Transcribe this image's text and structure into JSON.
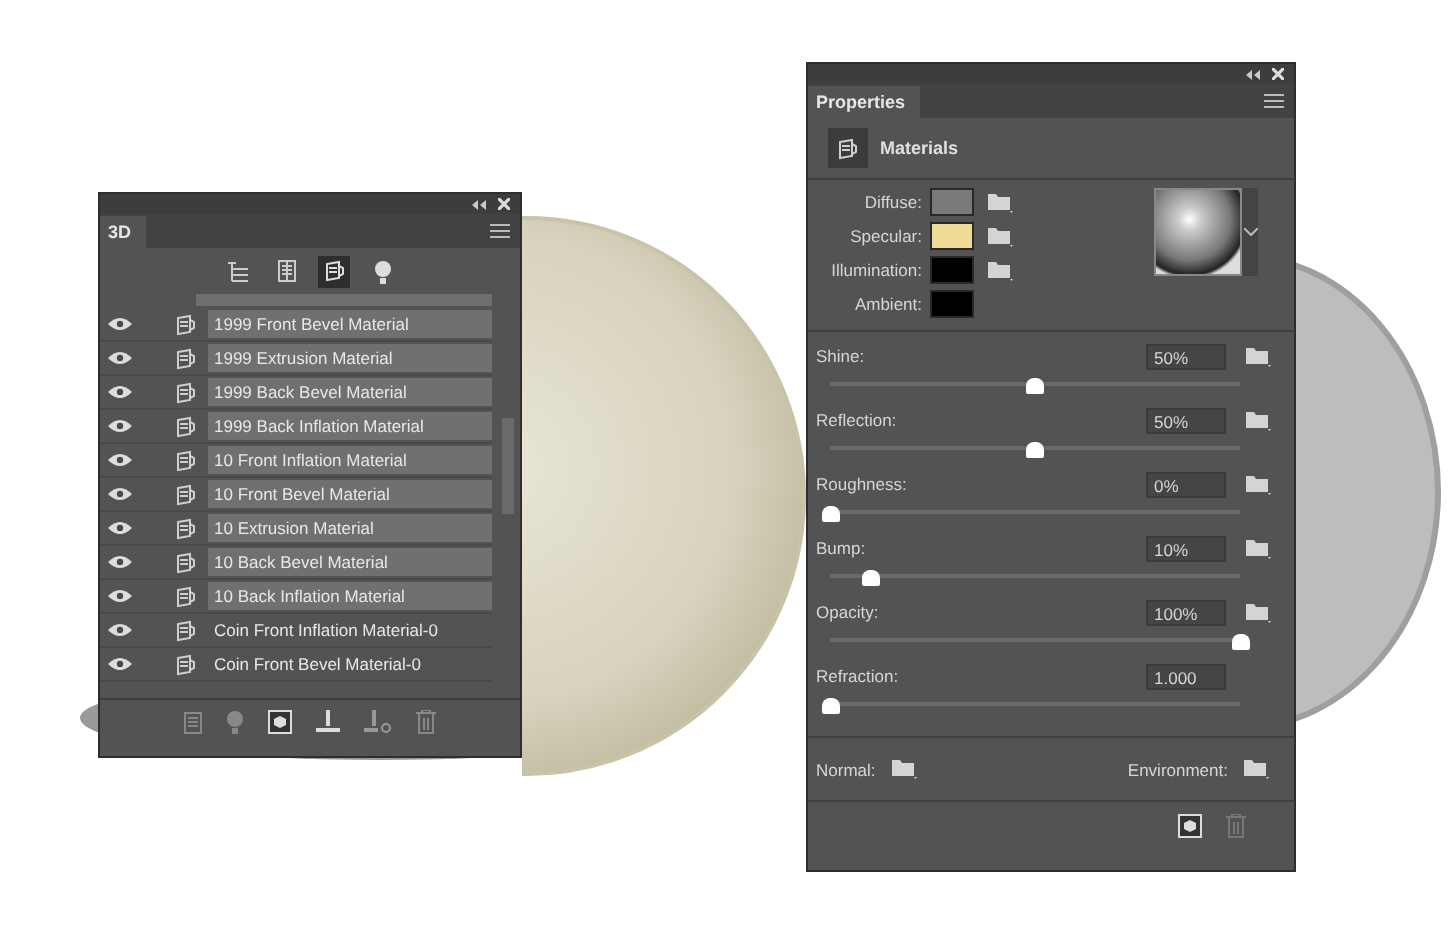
{
  "panel_3d": {
    "tab": "3D",
    "toolbar": [
      {
        "kind": "scene",
        "selected": false
      },
      {
        "kind": "mesh",
        "selected": false
      },
      {
        "kind": "material",
        "selected": true
      },
      {
        "kind": "light",
        "selected": false
      }
    ],
    "items": [
      {
        "label": "1999 Front Bevel Material",
        "visible": true,
        "selected": true
      },
      {
        "label": "1999 Extrusion Material",
        "visible": true,
        "selected": true
      },
      {
        "label": "1999 Back Bevel Material",
        "visible": true,
        "selected": true
      },
      {
        "label": "1999 Back Inflation Material",
        "visible": true,
        "selected": true
      },
      {
        "label": "10 Front Inflation Material",
        "visible": true,
        "selected": true
      },
      {
        "label": "10 Front Bevel Material",
        "visible": true,
        "selected": true
      },
      {
        "label": "10 Extrusion Material",
        "visible": true,
        "selected": true
      },
      {
        "label": "10 Back Bevel Material",
        "visible": true,
        "selected": true
      },
      {
        "label": "10 Back Inflation Material",
        "visible": true,
        "selected": true
      },
      {
        "label": "Coin Front Inflation Material-0",
        "visible": true,
        "selected": false
      },
      {
        "label": "Coin Front Bevel Material-0",
        "visible": true,
        "selected": false
      }
    ]
  },
  "properties": {
    "tab": "Properties",
    "header": "Materials",
    "swatches": [
      {
        "label": "Diffuse:",
        "color": "#7a7a7a",
        "texture_menu": true
      },
      {
        "label": "Specular:",
        "color": "#f0dc96",
        "texture_menu": true
      },
      {
        "label": "Illumination:",
        "color": "#000000",
        "texture_menu": true
      },
      {
        "label": "Ambient:",
        "color": "#000000",
        "texture_menu": false
      }
    ],
    "sliders": [
      {
        "label": "Shine:",
        "value": "50%",
        "level": 0.5,
        "texture_menu": true
      },
      {
        "label": "Reflection:",
        "value": "50%",
        "level": 0.5,
        "texture_menu": true
      },
      {
        "label": "Roughness:",
        "value": "0%",
        "level": 0,
        "texture_menu": true
      },
      {
        "label": "Bump:",
        "value": "10%",
        "level": 0.1,
        "texture_menu": true
      },
      {
        "label": "Opacity:",
        "value": "100%",
        "level": 1,
        "texture_menu": true
      },
      {
        "label": "Refraction:",
        "value": "1.000",
        "level": 0,
        "texture_menu": false
      }
    ],
    "maps": [
      {
        "label": "Normal:"
      },
      {
        "label": "Environment:"
      }
    ]
  }
}
